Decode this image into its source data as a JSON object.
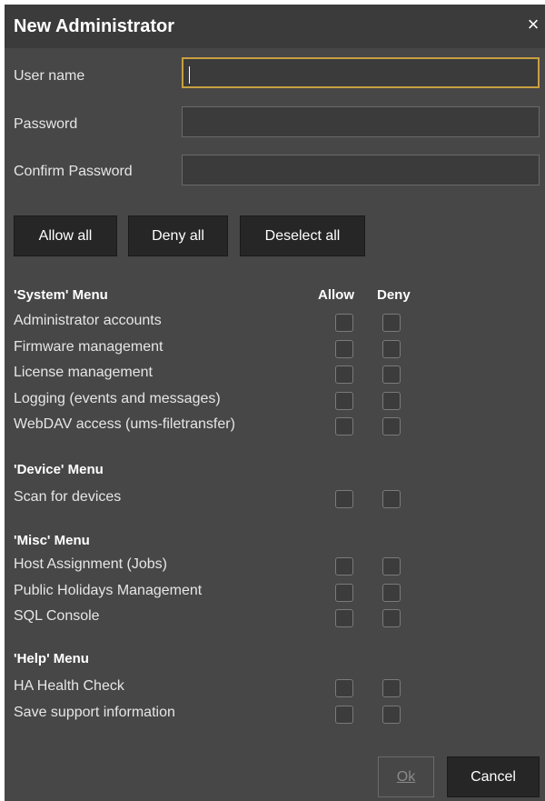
{
  "dialog": {
    "title": "New Administrator",
    "close_glyph": "×"
  },
  "fields": {
    "username_label": "User name",
    "username_value": "",
    "password_label": "Password",
    "password_value": "",
    "confirm_label": "Confirm Password",
    "confirm_value": ""
  },
  "actions": {
    "allow_all": "Allow all",
    "deny_all": "Deny all",
    "deselect_all": "Deselect all"
  },
  "columns": {
    "allow": "Allow",
    "deny": "Deny"
  },
  "sections": [
    {
      "title": "'System' Menu",
      "items": [
        {
          "label": "Administrator accounts",
          "allow": false,
          "deny": false
        },
        {
          "label": "Firmware management",
          "allow": false,
          "deny": false
        },
        {
          "label": "License management",
          "allow": false,
          "deny": false
        },
        {
          "label": "Logging (events and messages)",
          "allow": false,
          "deny": false
        },
        {
          "label": "WebDAV access (ums-filetransfer)",
          "allow": false,
          "deny": false
        }
      ]
    },
    {
      "title": "'Device' Menu",
      "items": [
        {
          "label": "Scan for devices",
          "allow": false,
          "deny": false
        }
      ]
    },
    {
      "title": "'Misc' Menu",
      "items": [
        {
          "label": "Host Assignment (Jobs)",
          "allow": false,
          "deny": false
        },
        {
          "label": "Public Holidays Management",
          "allow": false,
          "deny": false
        },
        {
          "label": "SQL Console",
          "allow": false,
          "deny": false
        }
      ]
    },
    {
      "title": "'Help' Menu",
      "items": [
        {
          "label": "HA Health Check",
          "allow": false,
          "deny": false
        },
        {
          "label": "Save support information",
          "allow": false,
          "deny": false
        }
      ]
    }
  ],
  "footer": {
    "ok_label": "Ok",
    "ok_enabled": false,
    "cancel_label": "Cancel"
  },
  "colors": {
    "dialog_bg": "#474747",
    "titlebar_bg": "#3b3b3b",
    "button_bg": "#262626",
    "focus_border": "#c8a040"
  }
}
